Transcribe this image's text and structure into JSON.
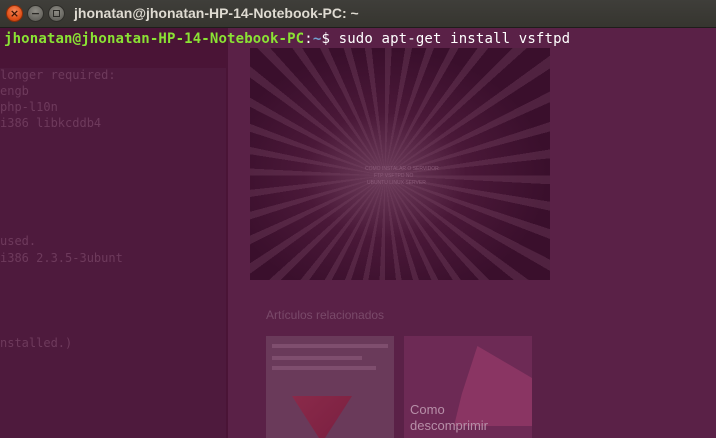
{
  "window": {
    "title": "jhonatan@jhonatan-HP-14-Notebook-PC: ~",
    "close_glyph": "×",
    "minimize_glyph": "−"
  },
  "terminal": {
    "prompt_user_host": "jhonatan@jhonatan-HP-14-Notebook-PC",
    "prompt_colon": ":",
    "prompt_path": "~",
    "prompt_symbol": "$ ",
    "command": "sudo apt-get install vsftpd"
  },
  "background": {
    "left_lines": [
      "longer required:",
      "engb",
      "php-l10n",
      "i386 libkcddb4",
      "",
      "",
      "",
      "",
      "",
      "used.",
      "i386 2.3.5-3ubunt",
      "",
      "",
      "",
      "",
      "nstalled.)"
    ],
    "image_caption": [
      "COMO INSTALAR O SERVIDOR",
      "FTP VSFTPD NO",
      "UBUNTU LINUX SERVER"
    ],
    "related_heading": "Artículos relacionados",
    "thumb2_lines": [
      "Como",
      "descomprimir"
    ]
  },
  "colors": {
    "prompt_user": "#8ae234",
    "prompt_path": "#729fcf",
    "terminal_bg": "#4a1436",
    "titlebar_bg": "#3c3b37"
  }
}
